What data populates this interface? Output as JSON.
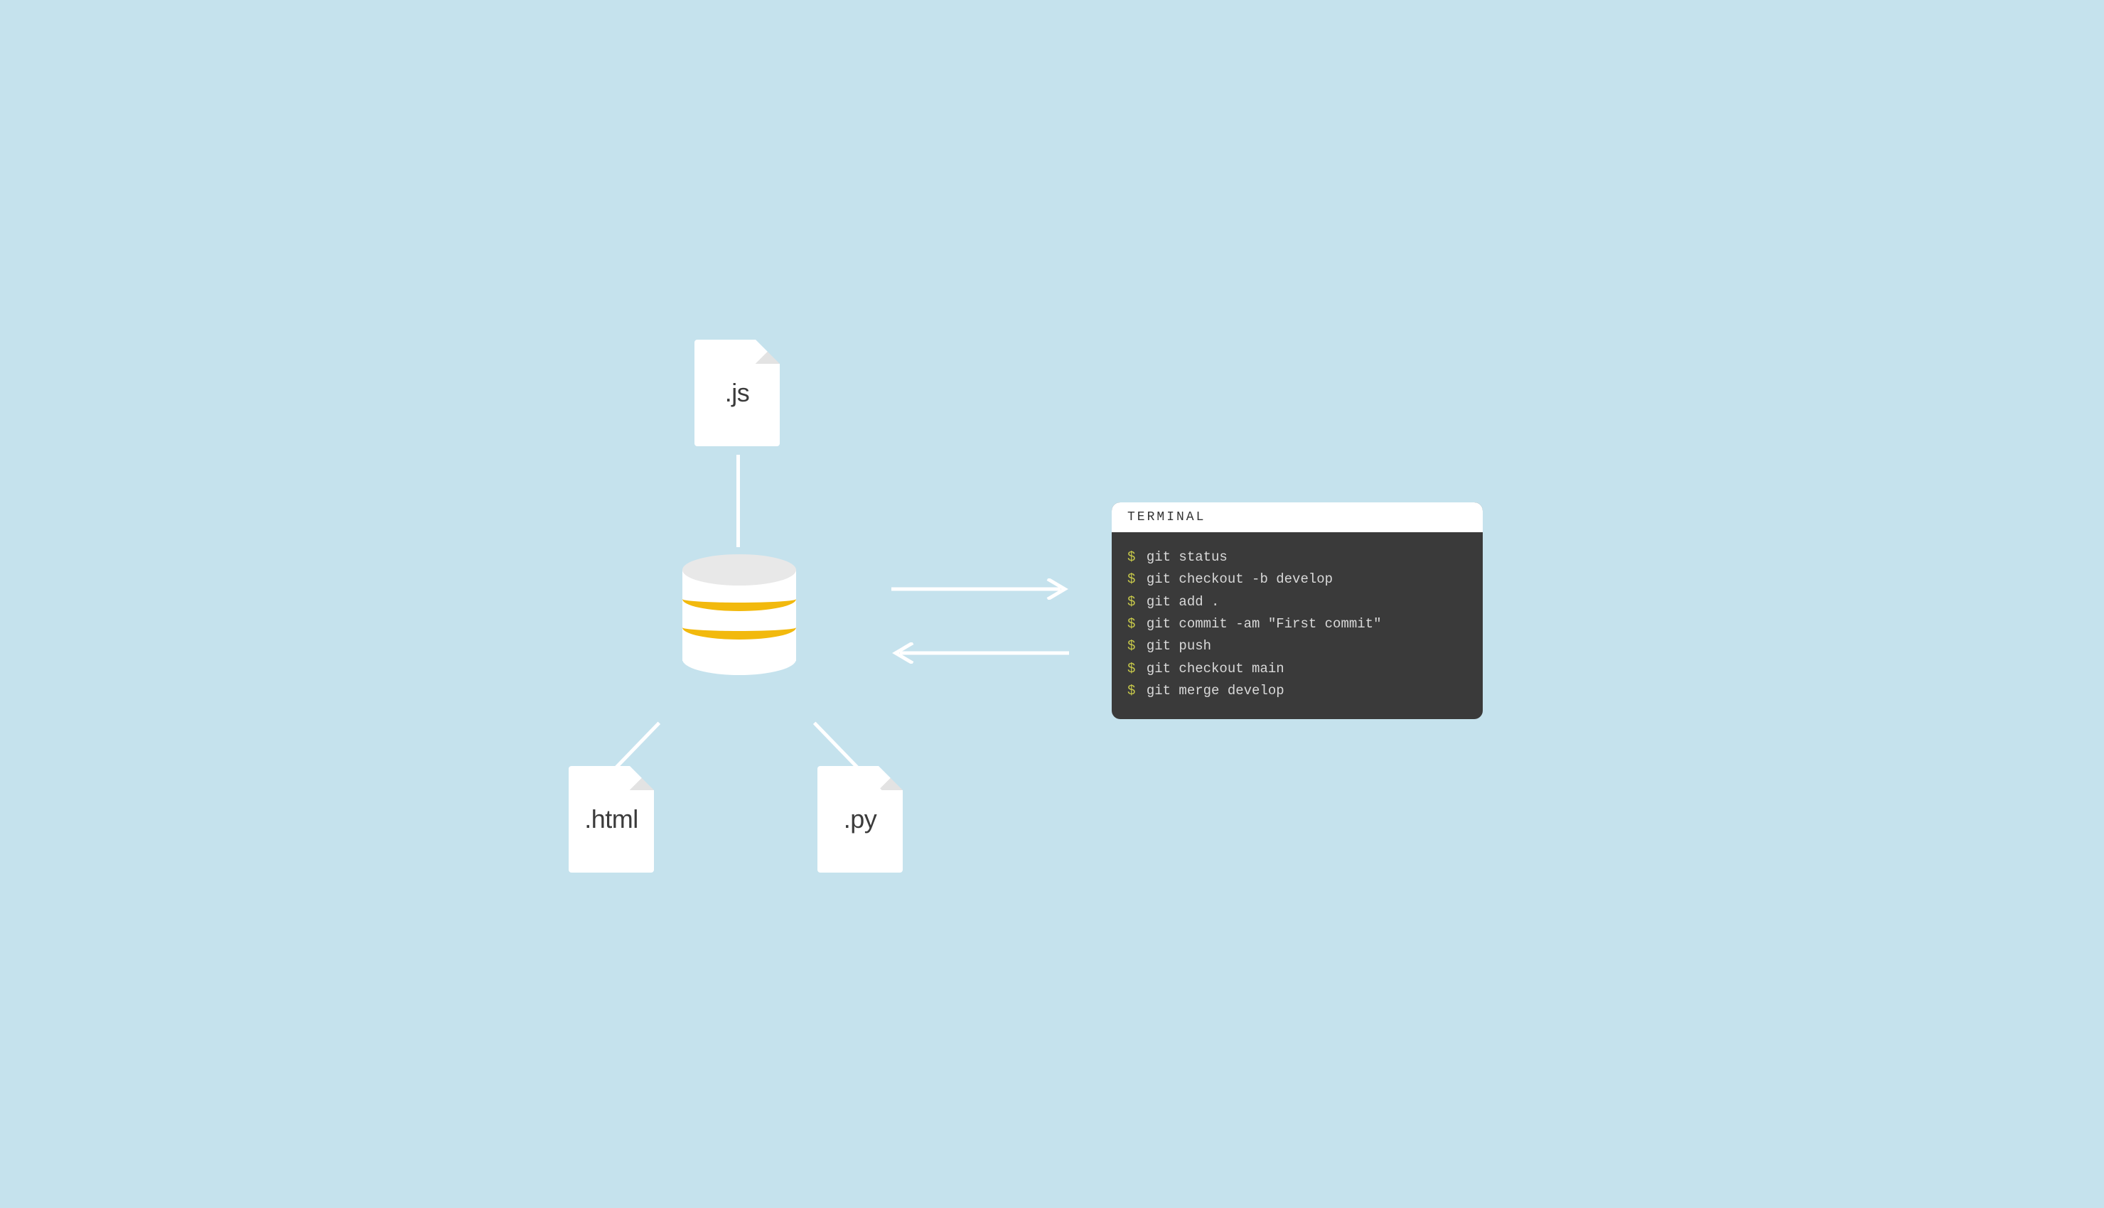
{
  "files": {
    "js": {
      "label": ".js"
    },
    "html": {
      "label": ".html"
    },
    "py": {
      "label": ".py"
    }
  },
  "terminal": {
    "title": "TERMINAL",
    "prompt": "$",
    "lines": [
      "git status",
      "git checkout -b develop",
      "git add .",
      "git commit -am \"First commit\"",
      "git push",
      "git checkout main",
      "git merge develop"
    ]
  }
}
